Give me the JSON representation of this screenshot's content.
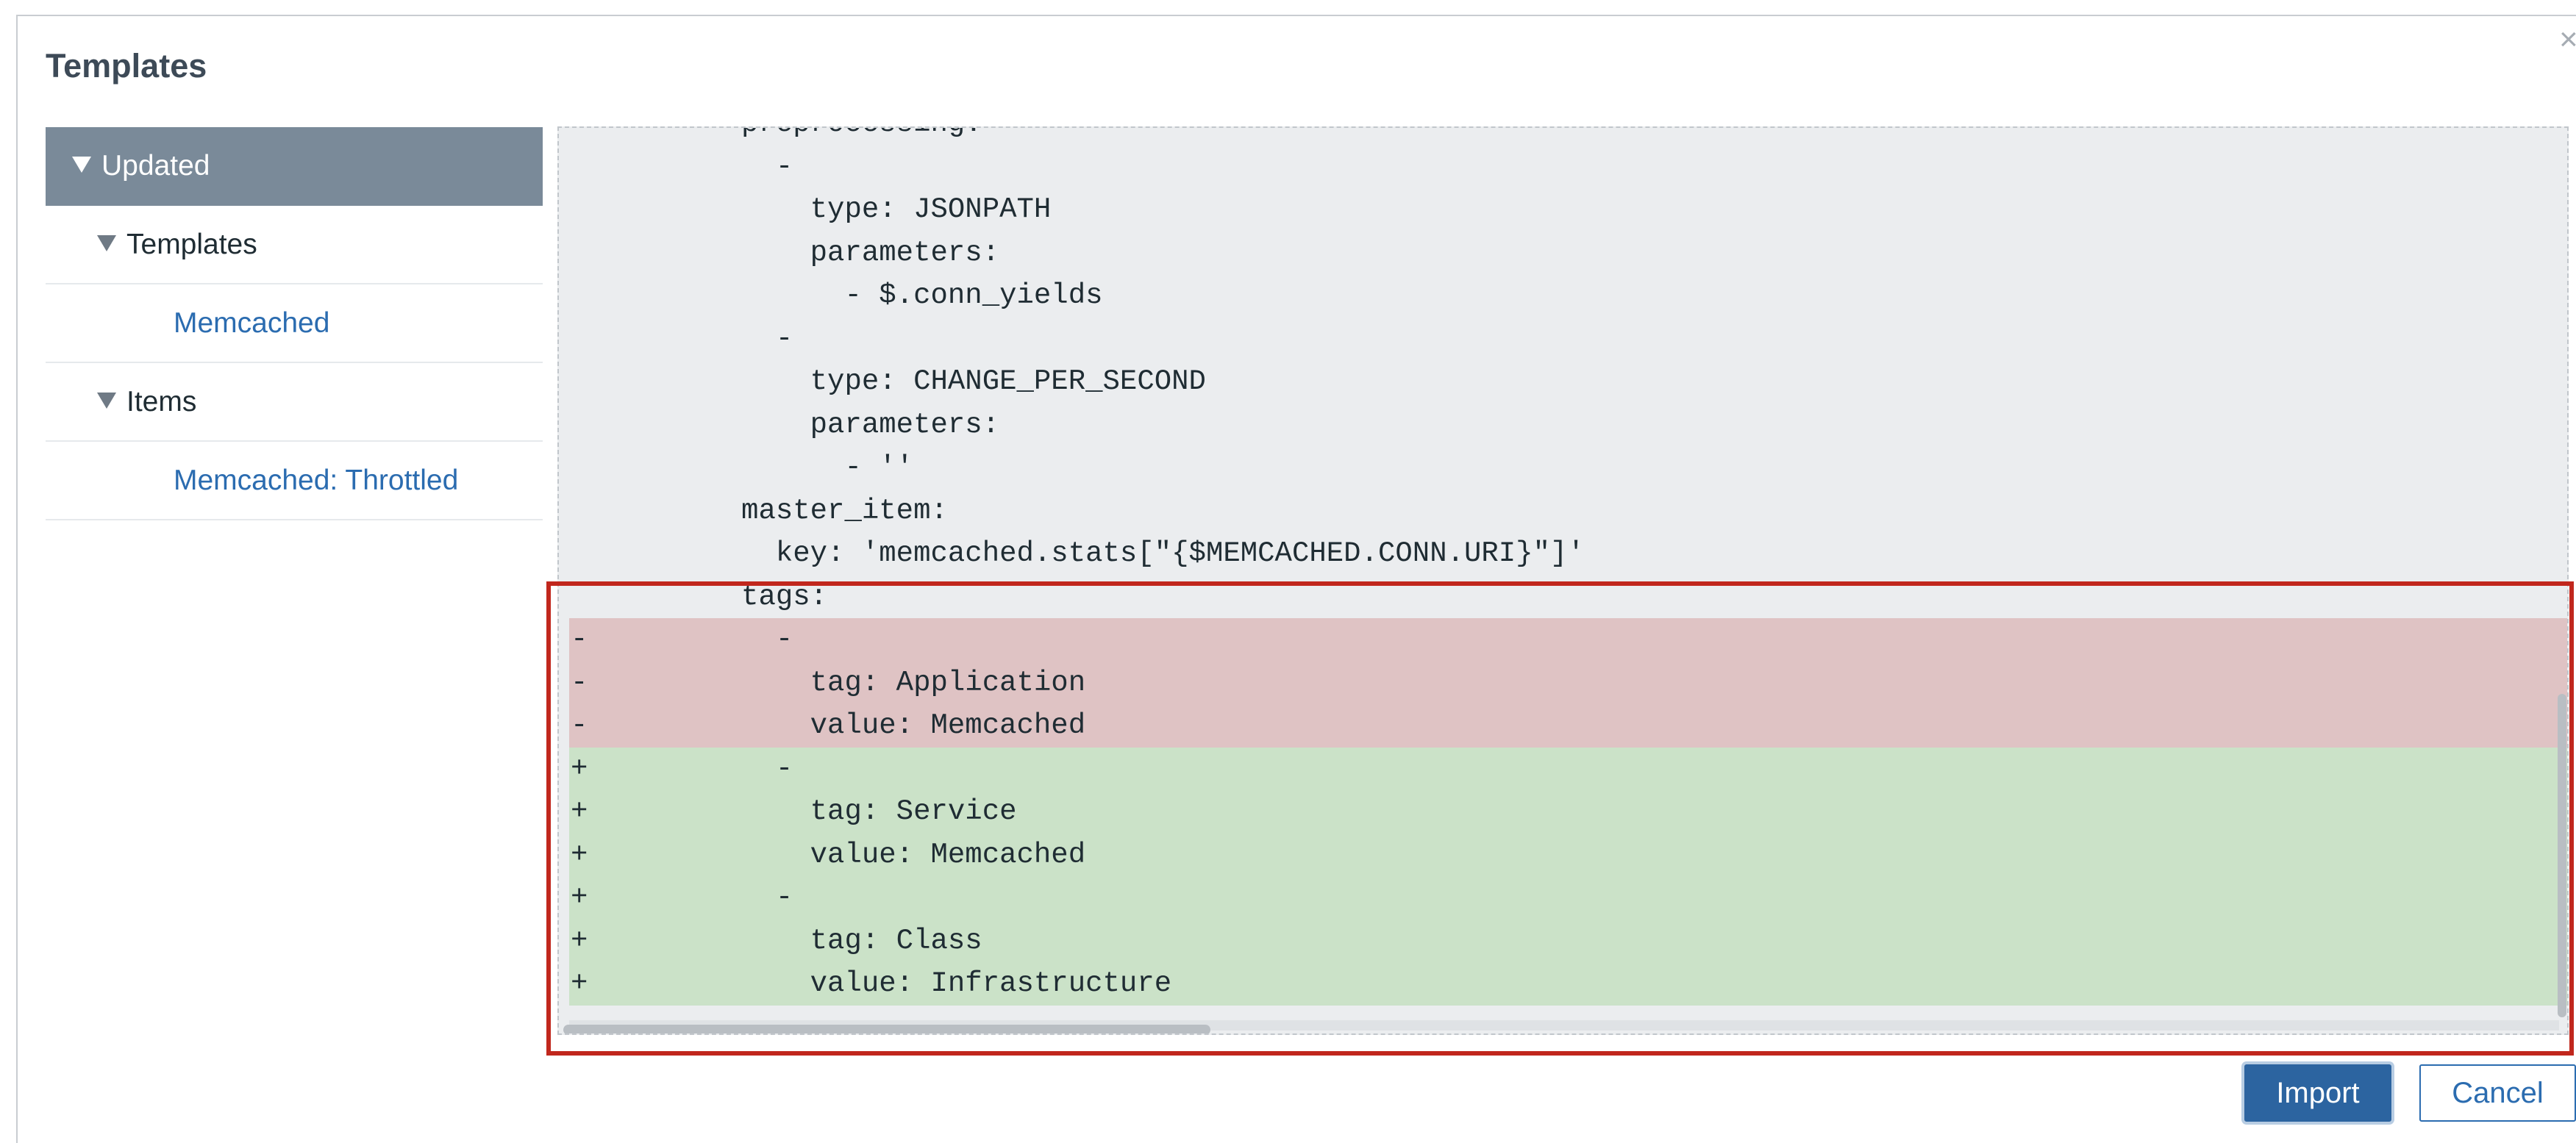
{
  "dialog": {
    "title": "Templates",
    "close_glyph": "×"
  },
  "sidebar": {
    "items": [
      {
        "label": "Updated",
        "kind": "active"
      },
      {
        "label": "Templates",
        "kind": "group"
      },
      {
        "label": "Memcached",
        "kind": "leaf"
      },
      {
        "label": "Items",
        "kind": "group"
      },
      {
        "label": "Memcached: Throttled",
        "kind": "leaf"
      }
    ]
  },
  "diff": {
    "lines": [
      {
        "type": "ctx",
        "marker": "",
        "text": "          preprocessing:"
      },
      {
        "type": "ctx",
        "marker": "",
        "text": "            -"
      },
      {
        "type": "ctx",
        "marker": "",
        "text": "              type: JSONPATH"
      },
      {
        "type": "ctx",
        "marker": "",
        "text": "              parameters:"
      },
      {
        "type": "ctx",
        "marker": "",
        "text": "                - $.conn_yields"
      },
      {
        "type": "ctx",
        "marker": "",
        "text": "            -"
      },
      {
        "type": "ctx",
        "marker": "",
        "text": "              type: CHANGE_PER_SECOND"
      },
      {
        "type": "ctx",
        "marker": "",
        "text": "              parameters:"
      },
      {
        "type": "ctx",
        "marker": "",
        "text": "                - ''"
      },
      {
        "type": "ctx",
        "marker": "",
        "text": "          master_item:"
      },
      {
        "type": "ctx",
        "marker": "",
        "text": "            key: 'memcached.stats[\"{$MEMCACHED.CONN.URI}\"]'"
      },
      {
        "type": "ctx",
        "marker": "",
        "text": "          tags:"
      },
      {
        "type": "rem",
        "marker": "-",
        "text": "            -"
      },
      {
        "type": "rem",
        "marker": "-",
        "text": "              tag: Application"
      },
      {
        "type": "rem",
        "marker": "-",
        "text": "              value: Memcached"
      },
      {
        "type": "add",
        "marker": "+",
        "text": "            -"
      },
      {
        "type": "add",
        "marker": "+",
        "text": "              tag: Service"
      },
      {
        "type": "add",
        "marker": "+",
        "text": "              value: Memcached"
      },
      {
        "type": "add",
        "marker": "+",
        "text": "            -"
      },
      {
        "type": "add",
        "marker": "+",
        "text": "              tag: Class"
      },
      {
        "type": "add",
        "marker": "+",
        "text": "              value: Infrastructure"
      }
    ]
  },
  "buttons": {
    "import_label": "Import",
    "cancel_label": "Cancel"
  },
  "colors": {
    "removed_bg": "#dfc3c4",
    "added_bg": "#cbe2c8",
    "active_item_bg": "#7a8a99",
    "primary_button": "#2c64a0",
    "highlight_border": "#c1271d"
  }
}
